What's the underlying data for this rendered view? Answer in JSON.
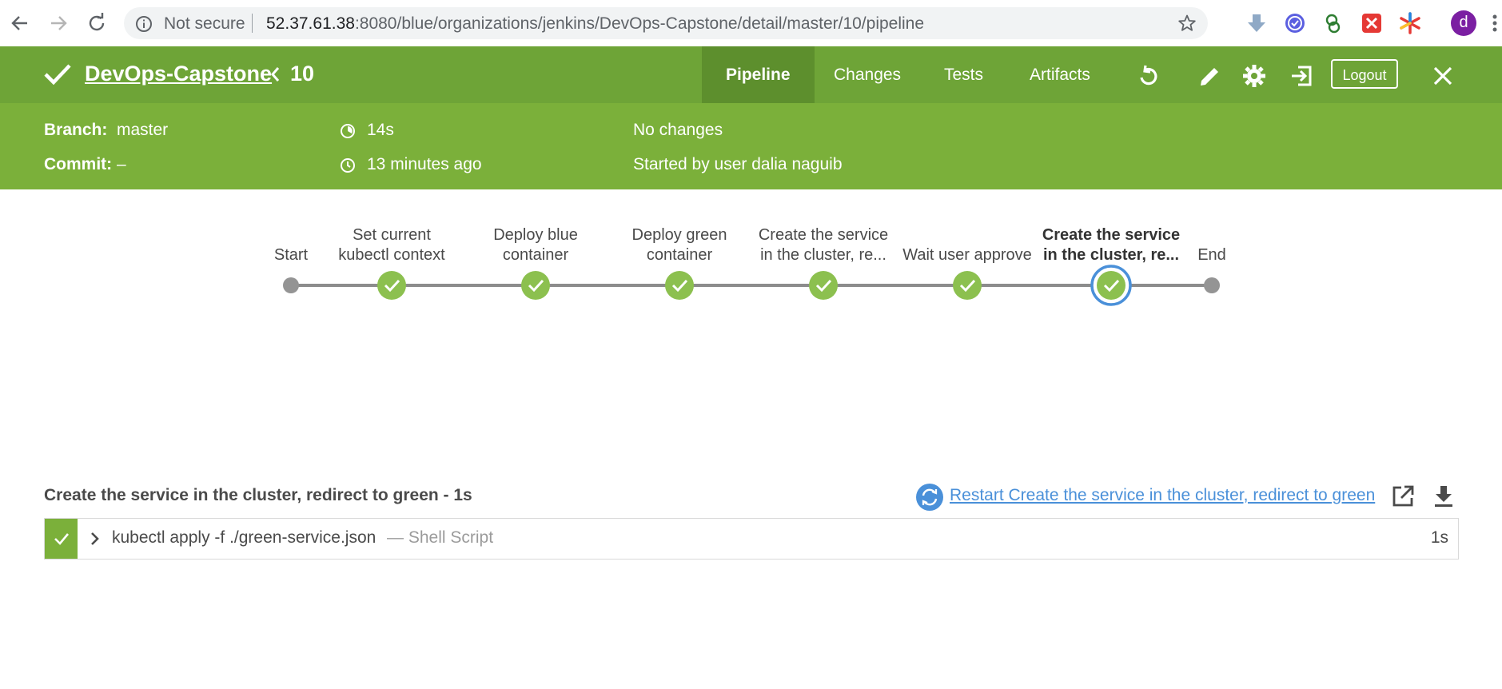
{
  "browser": {
    "security_label": "Not secure",
    "url_host": "52.37.61.38",
    "url_rest": ":8080/blue/organizations/jenkins/DevOps-Capstone/detail/master/10/pipeline",
    "profile_initial": "d"
  },
  "header": {
    "pipeline_name": "DevOps-Capstone",
    "run_number": "10",
    "tabs": [
      {
        "label": "Pipeline",
        "active": true
      },
      {
        "label": "Changes",
        "active": false
      },
      {
        "label": "Tests",
        "active": false
      },
      {
        "label": "Artifacts",
        "active": false
      }
    ],
    "logout_label": "Logout",
    "accent_color": "#6ea437"
  },
  "meta": {
    "branch_label": "Branch:",
    "branch_value": "master",
    "commit_label": "Commit:",
    "commit_value": "–",
    "duration": "14s",
    "time_ago": "13 minutes ago",
    "changes": "No changes",
    "started_by": "Started by user dalia naguib"
  },
  "pipeline": {
    "stages": [
      {
        "line1": "",
        "line2": "Start",
        "status": "none",
        "selected": false
      },
      {
        "line1": "Set current",
        "line2": "kubectl context",
        "status": "success",
        "selected": false
      },
      {
        "line1": "Deploy blue",
        "line2": "container",
        "status": "success",
        "selected": false
      },
      {
        "line1": "Deploy green",
        "line2": "container",
        "status": "success",
        "selected": false
      },
      {
        "line1": "Create the service",
        "line2": "in the cluster, re...",
        "status": "success",
        "selected": false
      },
      {
        "line1": "",
        "line2": "Wait user approve",
        "status": "success",
        "selected": false
      },
      {
        "line1": "Create the service",
        "line2": "in the cluster, re...",
        "status": "success",
        "selected": true
      },
      {
        "line1": "",
        "line2": "End",
        "status": "none",
        "selected": false
      }
    ]
  },
  "step": {
    "title": "Create the service in the cluster, redirect to green - 1s",
    "restart_link": "Restart Create the service in the cluster, redirect to green",
    "command": "kubectl apply -f ./green-service.json",
    "type": "— Shell Script",
    "duration": "1s"
  }
}
